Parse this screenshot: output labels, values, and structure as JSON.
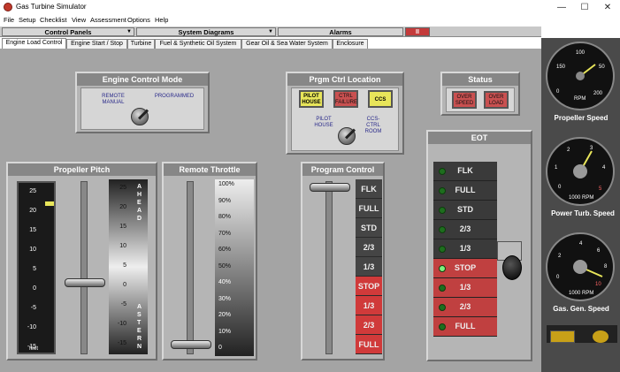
{
  "window": {
    "title": "Gas Turbine Simulator",
    "min": "—",
    "max": "☐",
    "close": "✕"
  },
  "menu": [
    "File",
    "Setup",
    "Checklist",
    "View",
    "Assessment",
    "Options",
    "Help"
  ],
  "dropdowns": [
    "Control Panels",
    "System Diagrams",
    "Alarms"
  ],
  "pause_label": "II",
  "tabs": [
    "Engine Load Control",
    "Engine Start / Stop",
    "Turbine",
    "Fuel & Synthetic Oil System",
    "Gear Oil & Sea Water System",
    "Enclosure"
  ],
  "ecm": {
    "title": "Engine Control Mode",
    "left": "REMOTE MANUAL",
    "right": "PROGRAMMED"
  },
  "pcl": {
    "title": "Prgm Ctrl Location",
    "b1": "PILOT HOUSE",
    "b2": "CTRL FAILURE",
    "b3": "CCS",
    "l1": "PILOT HOUSE",
    "l2": "CCS-CTRL ROOM"
  },
  "status": {
    "title": "Status",
    "b1": "OVER SPEED",
    "b2": "OVER LOAD"
  },
  "eot": {
    "title": "EOT",
    "rows": [
      "FLK",
      "FULL",
      "STD",
      "2/3",
      "1/3",
      "STOP",
      "1/3",
      "2/3",
      "FULL"
    ]
  },
  "pitch": {
    "title": "Propeller Pitch",
    "scale": [
      "25",
      "20",
      "15",
      "10",
      "5",
      "0",
      "-5",
      "-10",
      "-15"
    ],
    "unit": "feet",
    "ahead": "AHEAD",
    "astern": "ASTERN",
    "scale2": [
      "25",
      "20",
      "15",
      "10",
      "5",
      "0",
      "-5",
      "-10",
      "-15"
    ],
    "value": 0
  },
  "throttle": {
    "title": "Remote Throttle",
    "scale": [
      "100%",
      "90%",
      "80%",
      "70%",
      "60%",
      "50%",
      "40%",
      "30%",
      "20%",
      "10%",
      "0"
    ],
    "value": 0
  },
  "program": {
    "title": "Program Control",
    "rows": [
      "FLK",
      "FULL",
      "STD",
      "2/3",
      "1/3",
      "STOP",
      "1/3",
      "2/3",
      "FULL"
    ]
  },
  "g1": {
    "title": "Propeller Speed",
    "unit": "RPM",
    "t": [
      "100",
      "50",
      "0",
      "200",
      "150"
    ]
  },
  "g2": {
    "title": "Power Turb. Speed",
    "unit": "1000 RPM",
    "t": [
      "3",
      "2",
      "1",
      "0",
      "4",
      "5"
    ]
  },
  "g3": {
    "title": "Gas. Gen. Speed",
    "unit": "1000 RPM",
    "t": [
      "4",
      "6",
      "2",
      "0",
      "8",
      "10"
    ]
  },
  "colors": {
    "accent": "#c04040",
    "yellow": "#e8e55a"
  }
}
